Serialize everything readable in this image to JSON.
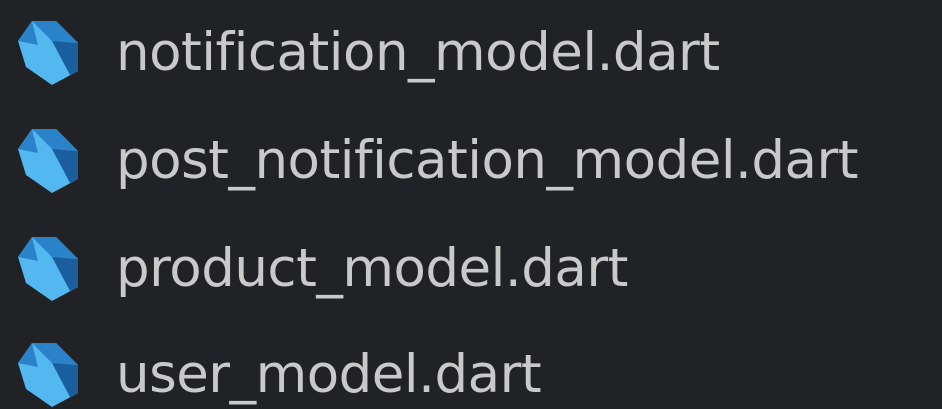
{
  "explorer": {
    "files": [
      {
        "name": "notification_model.dart",
        "icon": "dart-icon"
      },
      {
        "name": "post_notification_model.dart",
        "icon": "dart-icon"
      },
      {
        "name": "product_model.dart",
        "icon": "dart-icon"
      },
      {
        "name": "user_model.dart",
        "icon": "dart-icon"
      }
    ]
  },
  "colors": {
    "background": "#212226",
    "text": "#c9c9c9",
    "dart_light": "#54b8f0",
    "dart_mid": "#2a82c9",
    "dart_dark": "#1b5e9e"
  }
}
